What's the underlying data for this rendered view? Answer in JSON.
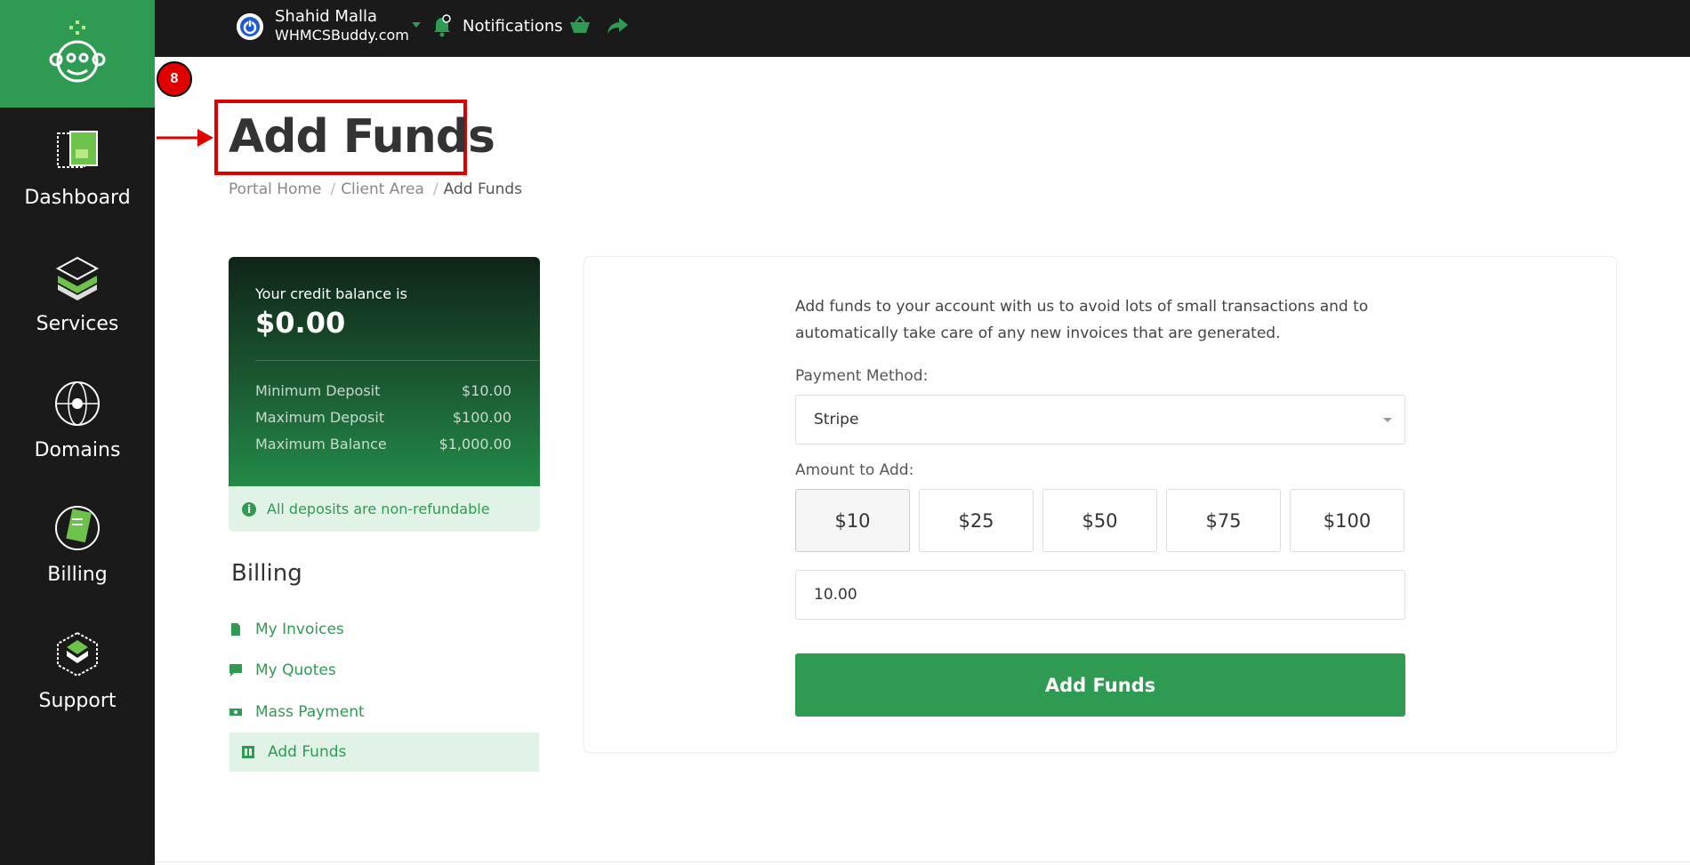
{
  "sidebar": {
    "items": [
      {
        "label": "Dashboard",
        "icon": "dashboard-icon"
      },
      {
        "label": "Services",
        "icon": "services-icon"
      },
      {
        "label": "Domains",
        "icon": "domains-icon"
      },
      {
        "label": "Billing",
        "icon": "billing-icon"
      },
      {
        "label": "Support",
        "icon": "support-icon"
      }
    ]
  },
  "topbar": {
    "user_name": "Shahid Malla",
    "company": "WHMCSBuddy.com",
    "notifications_label": "Notifications"
  },
  "annotation": {
    "step_number": "8"
  },
  "page": {
    "title": "Add Funds",
    "breadcrumb": [
      "Portal Home",
      "Client Area",
      "Add Funds"
    ]
  },
  "credit": {
    "label": "Your credit balance is",
    "amount": "$0.00",
    "rows": [
      {
        "label": "Minimum Deposit",
        "value": "$10.00"
      },
      {
        "label": "Maximum Deposit",
        "value": "$100.00"
      },
      {
        "label": "Maximum Balance",
        "value": "$1,000.00"
      }
    ],
    "notice": "All deposits are non-refundable"
  },
  "billing_menu": {
    "heading": "Billing",
    "items": [
      {
        "label": "My Invoices",
        "icon": "invoice-icon"
      },
      {
        "label": "My Quotes",
        "icon": "quote-icon"
      },
      {
        "label": "Mass Payment",
        "icon": "money-icon"
      },
      {
        "label": "Add Funds",
        "icon": "add-funds-icon",
        "active": true
      }
    ]
  },
  "form": {
    "intro": "Add funds to your account with us to avoid lots of small transactions and to automatically take care of any new invoices that are generated.",
    "payment_method_label": "Payment Method:",
    "payment_method_value": "Stripe",
    "amount_label": "Amount to Add:",
    "amount_options": [
      "$10",
      "$25",
      "$50",
      "$75",
      "$100"
    ],
    "amount_value": "10.00",
    "submit_label": "Add Funds"
  },
  "colors": {
    "brand_green": "#2e9a52",
    "sidebar_bg": "#1a1a1a",
    "annotation_red": "#e00000"
  }
}
